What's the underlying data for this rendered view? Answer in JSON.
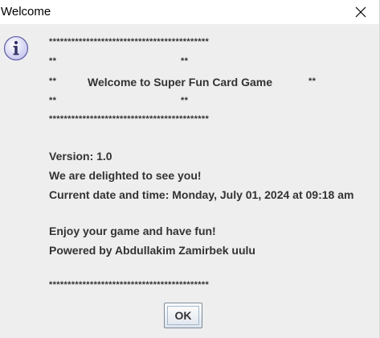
{
  "window": {
    "title": "Welcome",
    "close_icon": "close-icon",
    "info_icon": "info-icon"
  },
  "message": {
    "border_line": "*******************************************",
    "side_marker_left": "**",
    "side_marker_right": "**",
    "heading": "Welcome to Super Fun Card Game",
    "version": "Version: 1.0",
    "greeting": "We are delighted to see you!",
    "datetime": "Current date and time: Monday, July 01, 2024 at 09:18 am",
    "enjoy": "Enjoy your game and have fun!",
    "powered_by": "Powered by Abdullakim Zamirbek uulu"
  },
  "buttons": {
    "ok_label": "OK"
  },
  "colors": {
    "dialog_background": "#eeeeee",
    "text": "#333333",
    "icon_fill": "#d6d6f5",
    "icon_stroke": "#6666aa"
  }
}
